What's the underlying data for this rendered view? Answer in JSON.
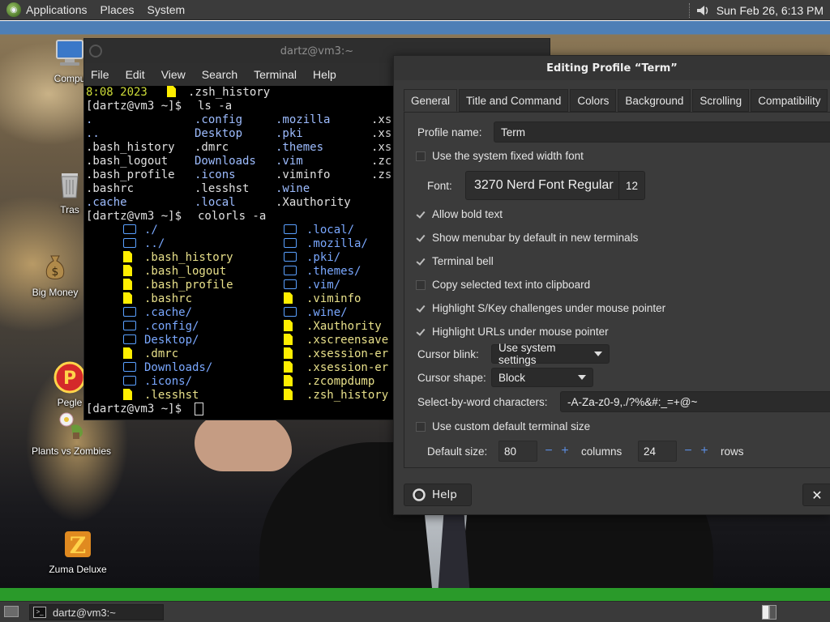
{
  "top_panel": {
    "menus": [
      "Applications",
      "Places",
      "System"
    ],
    "clock": "Sun Feb 26,  6:13 PM"
  },
  "desktop_icons": [
    {
      "label": "Compu",
      "icon": "computer-icon"
    },
    {
      "label": "Tras",
      "icon": "trash-icon"
    },
    {
      "label": "Big Money",
      "icon": "money-bag-icon"
    },
    {
      "label": "Pegle",
      "icon": "peggle-icon"
    },
    {
      "label": "Plants vs Zombies",
      "icon": "plants-vs-zombies-icon"
    },
    {
      "label": "Zuma Deluxe",
      "icon": "zuma-icon"
    }
  ],
  "terminal": {
    "title": "dartz@vm3:~",
    "menus": [
      "File",
      "Edit",
      "View",
      "Search",
      "Terminal",
      "Help"
    ],
    "first_line": {
      "time": "8:08 2023",
      "file": ".zsh_history"
    },
    "prompt": "[dartz@vm3 ~]$",
    "cmd1": "ls -a",
    "cmd2": "colorls -a",
    "ls_cols": [
      [
        ".",
        "..",
        ".bash_history",
        ".bash_logout",
        ".bash_profile",
        ".bashrc",
        ".cache"
      ],
      [
        ".config",
        "Desktop",
        ".dmrc",
        "Downloads",
        ".icons",
        ".lesshst",
        ".local"
      ],
      [
        ".mozilla",
        ".pki",
        ".themes",
        ".vim",
        ".viminfo",
        ".wine",
        ".Xauthority"
      ],
      [
        ".xs",
        ".xs",
        ".xs",
        ".zc",
        ".zs",
        "",
        ""
      ]
    ],
    "colorls_left": [
      {
        "t": "d",
        "n": "./"
      },
      {
        "t": "d",
        "n": "../"
      },
      {
        "t": "f",
        "n": ".bash_history"
      },
      {
        "t": "f",
        "n": ".bash_logout"
      },
      {
        "t": "f",
        "n": ".bash_profile"
      },
      {
        "t": "f",
        "n": ".bashrc"
      },
      {
        "t": "d",
        "n": ".cache/"
      },
      {
        "t": "d",
        "n": ".config/"
      },
      {
        "t": "d",
        "n": "Desktop/"
      },
      {
        "t": "f",
        "n": ".dmrc"
      },
      {
        "t": "d",
        "n": "Downloads/"
      },
      {
        "t": "d",
        "n": ".icons/"
      },
      {
        "t": "f",
        "n": ".lesshst"
      }
    ],
    "colorls_right": [
      {
        "t": "d",
        "n": ".local/"
      },
      {
        "t": "d",
        "n": ".mozilla/"
      },
      {
        "t": "d",
        "n": ".pki/"
      },
      {
        "t": "d",
        "n": ".themes/"
      },
      {
        "t": "d",
        "n": ".vim/"
      },
      {
        "t": "f",
        "n": ".viminfo"
      },
      {
        "t": "d",
        "n": ".wine/"
      },
      {
        "t": "f",
        "n": ".Xauthority"
      },
      {
        "t": "f",
        "n": ".xscreensave"
      },
      {
        "t": "f",
        "n": ".xsession-er"
      },
      {
        "t": "f",
        "n": ".xsession-er"
      },
      {
        "t": "f",
        "n": ".zcompdump"
      },
      {
        "t": "f",
        "n": ".zsh_history"
      }
    ]
  },
  "profile": {
    "title": "Editing Profile “Term”",
    "tabs": [
      "General",
      "Title and Command",
      "Colors",
      "Background",
      "Scrolling",
      "Compatibility"
    ],
    "profile_name_label": "Profile name:",
    "profile_name_value": "Term",
    "use_fixed_font": "Use the system fixed width font",
    "font_label": "Font:",
    "font_name": "3270 Nerd Font Regular",
    "font_size": "12",
    "allow_bold": "Allow bold text",
    "show_menubar": "Show menubar by default in new terminals",
    "terminal_bell": "Terminal bell",
    "copy_selected": "Copy selected text into clipboard",
    "highlight_skey": "Highlight S/Key challenges under mouse pointer",
    "highlight_urls": "Highlight URLs under mouse pointer",
    "cursor_blink_label": "Cursor blink:",
    "cursor_blink_value": "Use system settings",
    "cursor_shape_label": "Cursor shape:",
    "cursor_shape_value": "Block",
    "select_word_label": "Select-by-word characters:",
    "select_word_value": "-A-Za-z0-9,./?%&#:_=+@~",
    "custom_size": "Use custom default terminal size",
    "default_size_label": "Default size:",
    "columns_value": "80",
    "columns_label": "columns",
    "rows_value": "24",
    "rows_label": "rows",
    "help_label": "Help"
  },
  "taskbar": {
    "task_label": "dartz@vm3:~"
  }
}
